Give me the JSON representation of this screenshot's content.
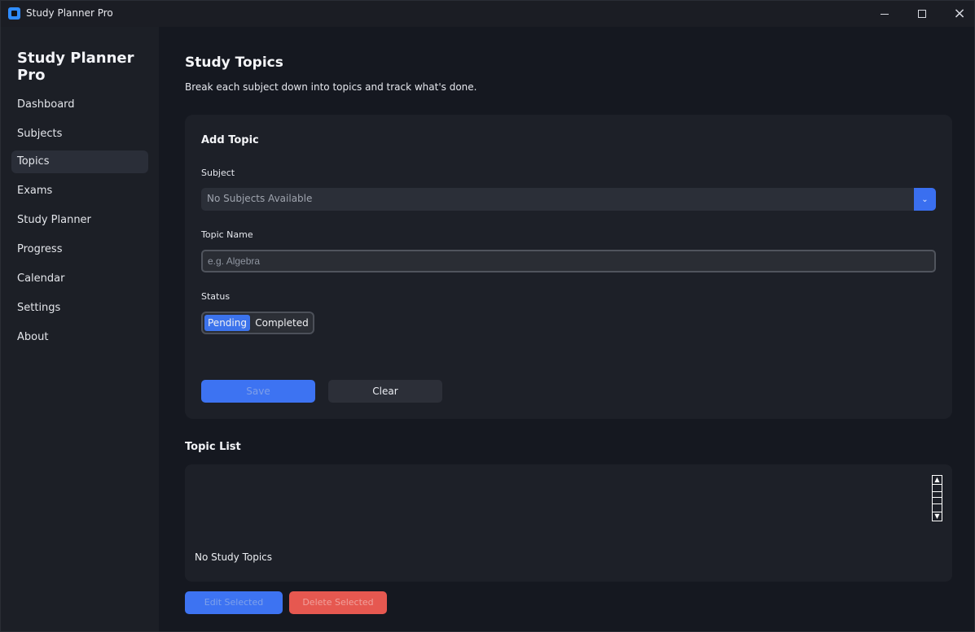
{
  "window": {
    "title": "Study Planner Pro",
    "icon": "app-logo-icon"
  },
  "sidebar": {
    "brand": "Study Planner Pro",
    "items": [
      {
        "label": "Dashboard"
      },
      {
        "label": "Subjects"
      },
      {
        "label": "Topics"
      },
      {
        "label": "Exams"
      },
      {
        "label": "Study Planner"
      },
      {
        "label": "Progress"
      },
      {
        "label": "Calendar"
      },
      {
        "label": "Settings"
      },
      {
        "label": "About"
      }
    ],
    "active": "Topics"
  },
  "page": {
    "title": "Study Topics",
    "subtitle": "Break each subject down into topics and track what's done."
  },
  "form": {
    "title": "Add Topic",
    "subject_label": "Subject",
    "subject_value": "No Subjects Available",
    "topic_label": "Topic Name",
    "topic_placeholder": "e.g. Algebra",
    "status_label": "Status",
    "status_options": [
      "Pending",
      "Completed"
    ],
    "status_selected": "Pending",
    "save_label": "Save",
    "clear_label": "Clear"
  },
  "topic_list": {
    "title": "Topic List",
    "empty_message": "No Study Topics"
  },
  "actions": {
    "edit_label": "Edit Selected",
    "delete_label": "Delete Selected"
  },
  "colors": {
    "accent": "#3d73f2",
    "danger": "#e65850",
    "background": "#151820",
    "panel": "#1d2028"
  }
}
